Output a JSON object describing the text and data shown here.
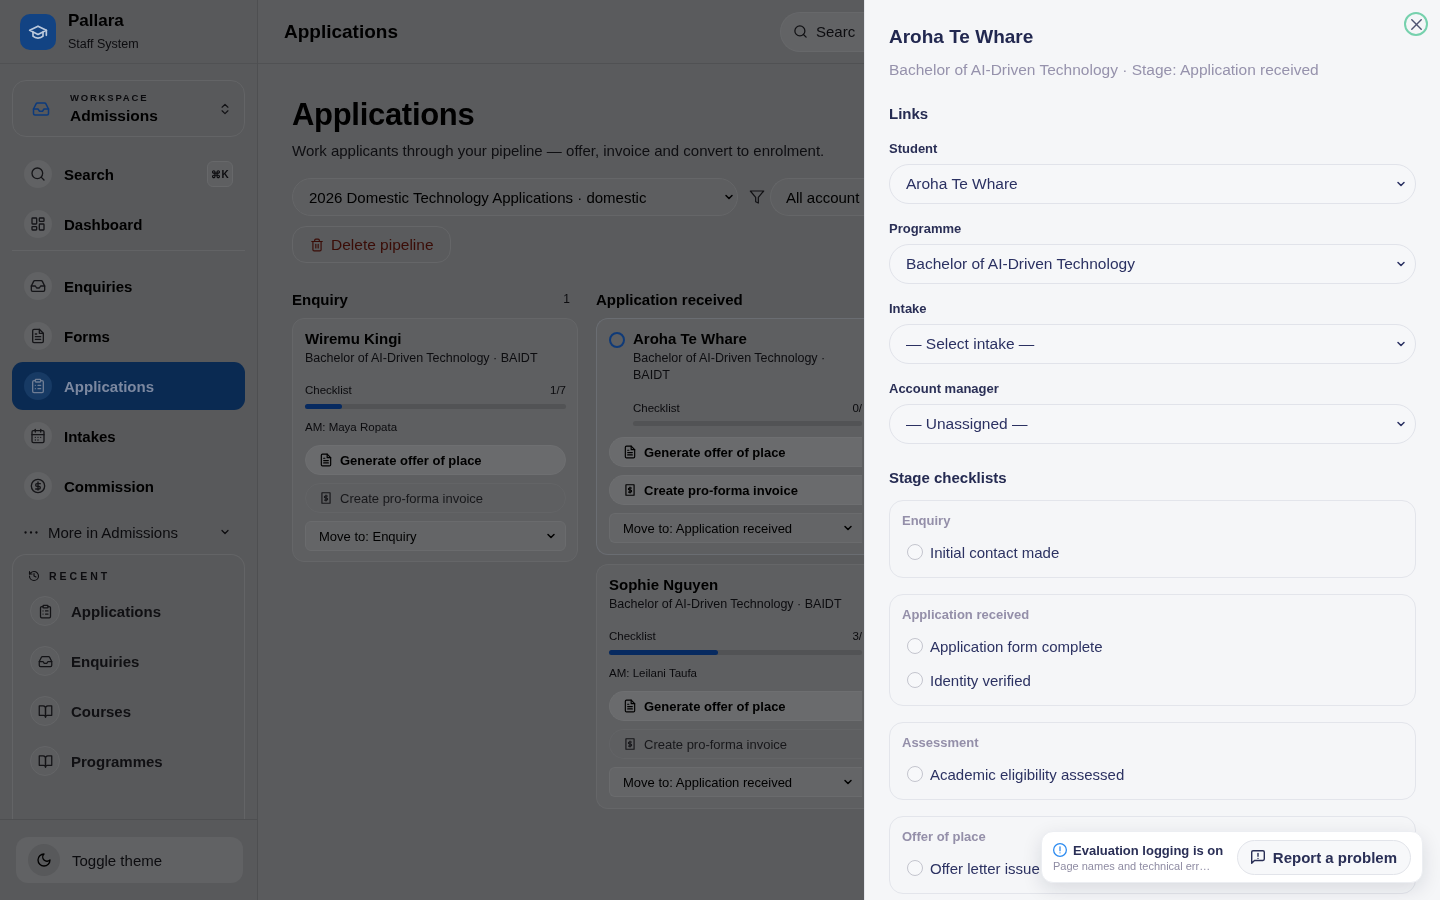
{
  "sidebar": {
    "brand": {
      "name": "Pallara",
      "tagline": "Staff System"
    },
    "workspace": {
      "label": "WORKSPACE",
      "value": "Admissions"
    },
    "nav_sections": [
      {
        "items": [
          {
            "label": "Search",
            "shortcut": "⌘K",
            "selected": false
          },
          {
            "label": "Dashboard",
            "selected": false
          }
        ]
      },
      {
        "items": [
          {
            "label": "Enquiries",
            "selected": false
          },
          {
            "label": "Forms",
            "selected": false
          },
          {
            "label": "Applications",
            "selected": true
          },
          {
            "label": "Intakes",
            "selected": false
          },
          {
            "label": "Commission",
            "selected": false
          }
        ]
      }
    ],
    "more": {
      "label": "More in Admissions",
      "expanded": false
    },
    "recent": {
      "title": "RECENT",
      "items": [
        {
          "label": "Applications"
        },
        {
          "label": "Enquiries"
        },
        {
          "label": "Courses"
        },
        {
          "label": "Programmes"
        }
      ]
    },
    "theme_button": {
      "label": "Toggle theme"
    }
  },
  "main": {
    "header": {
      "title": "Applications",
      "search": {
        "placeholder": "Searc"
      }
    },
    "title": "Applications",
    "subtitle": "Work applicants through your pipeline — offer, invoice and convert to enrolment.",
    "pipeline_select": {
      "value": "2026 Domestic Technology Applications · domestic"
    },
    "account_filter": {
      "value": "All account"
    },
    "delete_button": {
      "label": "Delete pipeline"
    },
    "columns": [
      {
        "title": "Enquiry",
        "count": "1",
        "cards": [
          {
            "name": "Wiremu Kingi",
            "selected": false,
            "programme": "Bachelor of AI-Driven Technology · BAIDT",
            "checklist": {
              "label": "Checklist",
              "count": "1/7",
              "level": 0.14
            },
            "account_manager": "AM: Maya Ropata",
            "actions": [
              {
                "label": "Generate offer of place",
                "disabled": false
              },
              {
                "label": "Create pro-forma invoice",
                "disabled": true
              }
            ],
            "move_to": "Move to: Enquiry"
          }
        ]
      },
      {
        "title": "Application received",
        "cards": [
          {
            "name": "Aroha Te Whare",
            "selected": true,
            "programme": "Bachelor of AI-Driven Technology · BAIDT",
            "checklist": {
              "label": "Checklist",
              "count": "0/",
              "level": 0
            },
            "actions": [
              {
                "label": "Generate offer of place",
                "disabled": false
              },
              {
                "label": "Create pro-forma invoice",
                "disabled": false
              }
            ],
            "move_to": "Move to: Application received"
          },
          {
            "name": "Sophie Nguyen",
            "selected": false,
            "programme": "Bachelor of AI-Driven Technology · BAIDT",
            "checklist": {
              "label": "Checklist",
              "count": "3/",
              "level": 0.43
            },
            "account_manager": "AM: Leilani Taufa",
            "actions": [
              {
                "label": "Generate offer of place",
                "disabled": false
              },
              {
                "label": "Create pro-forma invoice",
                "disabled": true
              }
            ],
            "move_to": "Move to: Application received"
          }
        ]
      }
    ]
  },
  "drawer": {
    "title": "Aroha Te Whare",
    "subtitle": "Bachelor of AI-Driven Technology · Stage: Application received",
    "links": {
      "heading": "Links",
      "fields": [
        {
          "label": "Student",
          "value": "Aroha Te Whare"
        },
        {
          "label": "Programme",
          "value": "Bachelor of AI-Driven Technology"
        },
        {
          "label": "Intake",
          "value": "— Select intake —"
        },
        {
          "label": "Account manager",
          "value": "— Unassigned —"
        }
      ]
    },
    "checklists": {
      "heading": "Stage checklists",
      "groups": [
        {
          "stage": "Enquiry",
          "items": [
            {
              "label": "Initial contact made",
              "checked": false
            }
          ]
        },
        {
          "stage": "Application received",
          "items": [
            {
              "label": "Application form complete",
              "checked": false
            },
            {
              "label": "Identity verified",
              "checked": false
            }
          ]
        },
        {
          "stage": "Assessment",
          "items": [
            {
              "label": "Academic eligibility assessed",
              "checked": false
            }
          ]
        },
        {
          "stage": "Offer of place",
          "items": [
            {
              "label": "Offer letter issue",
              "checked": false
            }
          ]
        }
      ]
    }
  },
  "toast": {
    "title": "Evaluation logging is on",
    "message": "Page names and technical err…",
    "button": "Report a problem"
  }
}
